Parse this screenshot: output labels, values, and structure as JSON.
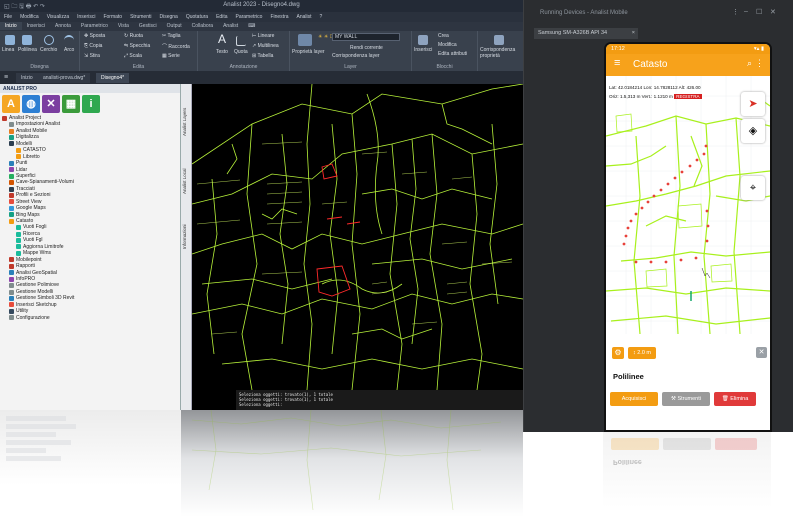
{
  "cad": {
    "app_title": "Analist 2023 - Disegno4.dwg",
    "title_left": "◱ 🗀 🖫 🖶 ↶ ↷",
    "menus": [
      "File",
      "Modifica",
      "Visualizza",
      "Inserisci",
      "Formato",
      "Strumenti",
      "Disegna",
      "Quotatura",
      "Edita",
      "Parametrico",
      "Finestra",
      "Analist",
      "?"
    ],
    "ribbon_tabs": [
      "Inizio",
      "Inserisci",
      "Annota",
      "Parametrico",
      "Vista",
      "Gestisci",
      "Output",
      "Collabora",
      "Analist",
      "⌨"
    ],
    "ribbon": {
      "draw_label": "Disegna",
      "edit_label": "Edita",
      "annot_label": "Annotazione",
      "layer_label": "Layer",
      "block_label": "Blocchi",
      "buttons": {
        "linea": "Linea",
        "polilinea": "Polilinea",
        "cerchio": "Cerchio",
        "arco": "Arco",
        "sposta": "Sposta",
        "ruota": "Ruota",
        "taglia": "Taglia",
        "copia": "Copia",
        "specchia": "Specchia",
        "raccorda": "Raccorda",
        "stira": "Stira",
        "scala": "Scala",
        "serie": "Serie",
        "testo": "Testo",
        "quota": "Quota",
        "lineare": "Lineare",
        "multilinea": "Multilinea",
        "tabella": "Tabella",
        "proprieta_layer": "Proprietà layer",
        "rendi_corrente": "Rendi corrente",
        "corrispondenza": "Corrispondenza layer",
        "inserisci": "Inserisci",
        "crea": "Crea",
        "modifica": "Modifica",
        "edita_attributi": "Edita attributi",
        "corrispondenza_prop": "Corrispondenza proprietà"
      },
      "layer_combo": "MY WALL"
    },
    "doc_tabs": [
      "Inizio",
      "analisti-prova.dwg*",
      "Disegno4*"
    ],
    "panel": {
      "header": "ANALIST PRO",
      "icons": [
        {
          "name": "analist-icon",
          "glyph": "A",
          "color": "#f5a623"
        },
        {
          "name": "globe-icon",
          "glyph": "◍",
          "color": "#2d7fd3"
        },
        {
          "name": "satellite-icon",
          "glyph": "✕",
          "color": "#7b3fa0"
        },
        {
          "name": "map-icon",
          "glyph": "▦",
          "color": "#3b9b3b"
        },
        {
          "name": "info-icon",
          "glyph": "i",
          "color": "#2fa84f"
        }
      ],
      "tree": [
        {
          "label": "Analist Project",
          "indent": 0,
          "color": "#c0392b"
        },
        {
          "label": "Impostazioni Analist",
          "indent": 1,
          "color": "#7f8c8d"
        },
        {
          "label": "Analist Mobile",
          "indent": 1,
          "color": "#e67e22"
        },
        {
          "label": "Digitalizza",
          "indent": 1,
          "color": "#16a085"
        },
        {
          "label": "Modelli",
          "indent": 1,
          "color": "#2c3e50"
        },
        {
          "label": "CATASTO",
          "indent": 2,
          "color": "#f39c12"
        },
        {
          "label": "Libretto",
          "indent": 2,
          "color": "#f39c12"
        },
        {
          "label": "Punti",
          "indent": 1,
          "color": "#2980b9"
        },
        {
          "label": "Lidar",
          "indent": 1,
          "color": "#8e44ad"
        },
        {
          "label": "Superfici",
          "indent": 1,
          "color": "#27ae60"
        },
        {
          "label": "Cave-Spianamenti-Volumi",
          "indent": 1,
          "color": "#d35400"
        },
        {
          "label": "Tracciati",
          "indent": 1,
          "color": "#2c3e50"
        },
        {
          "label": "Profili e Sezioni",
          "indent": 1,
          "color": "#c0392b"
        },
        {
          "label": "Street View",
          "indent": 1,
          "color": "#e74c3c"
        },
        {
          "label": "Google Maps",
          "indent": 1,
          "color": "#3498db"
        },
        {
          "label": "Bing Maps",
          "indent": 1,
          "color": "#16a085"
        },
        {
          "label": "Catasto",
          "indent": 1,
          "color": "#f39c12"
        },
        {
          "label": "Vuoti Fogli",
          "indent": 2,
          "color": "#1abc9c"
        },
        {
          "label": "Ricerca",
          "indent": 2,
          "color": "#1abc9c"
        },
        {
          "label": "Vuoti Fgl",
          "indent": 2,
          "color": "#1abc9c"
        },
        {
          "label": "Aggiorna Limitrofe",
          "indent": 2,
          "color": "#1abc9c"
        },
        {
          "label": "Mappe Wms",
          "indent": 2,
          "color": "#1abc9c"
        },
        {
          "label": "Mobilepoint",
          "indent": 1,
          "color": "#c0392b"
        },
        {
          "label": "Rapporti",
          "indent": 1,
          "color": "#c0392b"
        },
        {
          "label": "Analisi GeoSpatial",
          "indent": 1,
          "color": "#2980b9"
        },
        {
          "label": "InfoPRO",
          "indent": 1,
          "color": "#8e44ad"
        },
        {
          "label": "Gestione Polimiove",
          "indent": 1,
          "color": "#7f8c8d"
        },
        {
          "label": "Gestione Modelli",
          "indent": 1,
          "color": "#7f8c8d"
        },
        {
          "label": "Gestione Simboli 3D Revit",
          "indent": 1,
          "color": "#2980b9"
        },
        {
          "label": "Inserisci Sketchup",
          "indent": 1,
          "color": "#e74c3c"
        },
        {
          "label": "Utility",
          "indent": 1,
          "color": "#34495e"
        },
        {
          "label": "Configurazione",
          "indent": 1,
          "color": "#7f8c8d"
        }
      ]
    },
    "vtabs": [
      "Analist Layers",
      "Analist Local",
      "Informazioni"
    ],
    "command_lines": [
      "Seleziona oggetti: trovato(1), 1 totale",
      "Seleziona oggetti: trovato(1), 1 totale",
      "Seleziona oggetti:"
    ]
  },
  "emulator": {
    "window_title": "Running Devices - Analist Mobile",
    "device_tab": "Samsung SM-A326B API 34",
    "status_time": "17:12",
    "status_right": "▾▴ ▮",
    "app_title": "Catasto",
    "coords_line1": "Lat: 42.0184214   Lon: 14.7828112   Alt: 426.00",
    "coords_line2": "Oriz: 1.5,313 m   Vert.: 1.1210 m",
    "rec_badge": "REGISTRA",
    "distance_chip": "2.0 m",
    "sheet_title": "Polilinee",
    "buttons": {
      "acquisisci": "Acquisisci",
      "strumenti": "Strumenti",
      "elimina": "Elimina"
    },
    "colors": {
      "accent": "#f39c12",
      "gray": "#9a9a9a",
      "danger": "#e03a3a"
    }
  }
}
